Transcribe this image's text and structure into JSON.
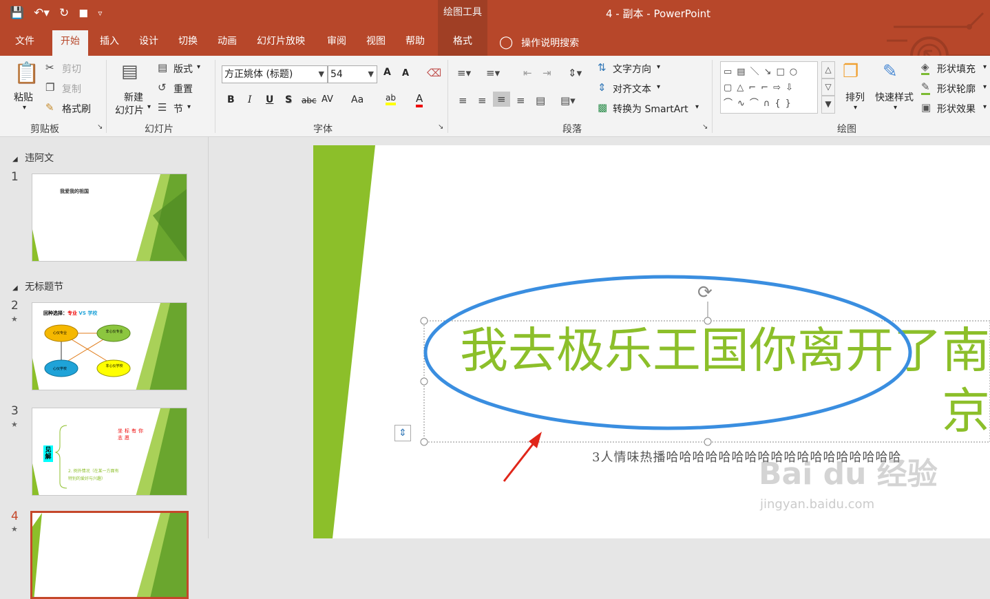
{
  "app": {
    "contextual_group": "绘图工具",
    "title": "4 - 副本  -  PowerPoint"
  },
  "qat": {
    "icons": [
      "save-icon",
      "undo-icon",
      "redo-icon",
      "present-from-start-icon",
      "customize-qat-icon"
    ]
  },
  "tabs": [
    "文件",
    "开始",
    "插入",
    "设计",
    "切换",
    "动画",
    "幻灯片放映",
    "审阅",
    "视图",
    "帮助",
    "格式"
  ],
  "active_tab": "开始",
  "search_label": "操作说明搜索",
  "ribbon": {
    "clipboard": {
      "label": "剪贴板",
      "paste": "粘贴",
      "cut": "剪切",
      "copy": "复制",
      "format_painter": "格式刷"
    },
    "slides": {
      "label": "幻灯片",
      "new_slide_line1": "新建",
      "new_slide_line2": "幻灯片",
      "layout": "版式",
      "reset": "重置",
      "section": "节"
    },
    "font": {
      "label": "字体",
      "font_name": "方正姚体 (标题)",
      "font_size": "54",
      "bold": "B",
      "italic": "I",
      "underline": "U",
      "shadow": "S",
      "strike": "abc",
      "spacing": "AV",
      "case": "Aa",
      "grow": "A",
      "shrink": "A",
      "highlight": "ab",
      "font_color": "A"
    },
    "paragraph": {
      "label": "段落",
      "text_direction": "文字方向",
      "align_text": "对齐文本",
      "smartart": "转换为 SmartArt"
    },
    "drawing": {
      "label": "绘图",
      "arrange": "排列",
      "quick_styles": "快速样式",
      "shape_fill": "形状填充",
      "shape_outline": "形状轮廓",
      "shape_effects": "形状效果",
      "shapes_gallery": "▭▤＼↘□○ ▢△⌐⌐⇨⇩ ⌒∿⌒∩{}"
    }
  },
  "colors": {
    "brand": "#b7472a",
    "accent_green": "#8cbf2a",
    "annotation_blue": "#3a8ee0",
    "arrow_red": "#e0261a"
  },
  "sections": [
    {
      "name": "违阿文"
    },
    {
      "name": "无标题节"
    }
  ],
  "slides": [
    {
      "number": "1",
      "star": "",
      "text": "我爱我的祖国"
    },
    {
      "number": "2",
      "star": "★",
      "title_a": "回种选择：",
      "title_b": "专业",
      "title_c": " VS ",
      "title_d": "学校",
      "n1": "心仪专业",
      "n2": "非心仪专业",
      "n3": "心仪学校",
      "n4": "非心仪学校"
    },
    {
      "number": "3",
      "star": "★",
      "left": "见解",
      "red": "坐标有你志愿",
      "green1": "2. 例外情况（在某一方面有",
      "green2": "特别的爱好与兴趣）"
    },
    {
      "number": "4",
      "star": "★"
    }
  ],
  "slide_main": {
    "title_line1": "我去极乐王国你离开了南",
    "title_line2": "京",
    "subtitle": "3人情味热播哈哈哈哈哈哈哈哈哈哈哈哈哈哈哈哈哈哈"
  },
  "watermark": {
    "logo": "Bai du 经验",
    "url": "jingyan.baidu.com"
  }
}
